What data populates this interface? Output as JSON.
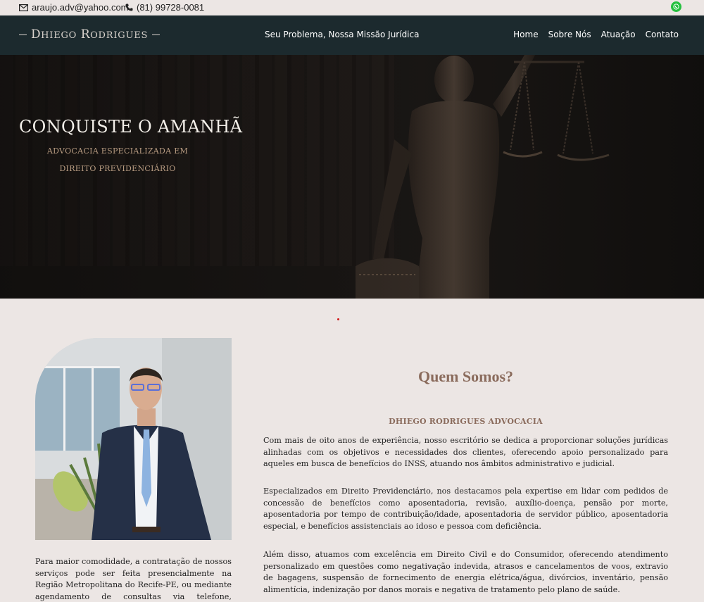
{
  "topbar": {
    "email": "araujo.adv@yahoo.com",
    "phone": "(81) 99728-0081",
    "icons": [
      "mail-icon",
      "phone-icon",
      "whatsapp-icon"
    ]
  },
  "nav": {
    "brand_first_initial": "D",
    "brand_first_rest": "hiego",
    "brand_last_initial": "R",
    "brand_last_rest": "odrigues",
    "tagline": "Seu Problema, Nossa Missão Jurídica",
    "menu": [
      "Home",
      "Sobre Nós",
      "Atuação",
      "Contato"
    ]
  },
  "hero": {
    "title": "CONQUISTE O AMANHÃ",
    "subtitle": "ADVOCACIA ESPECIALIZADA EM DIREITO PREVIDENCIÁRIO"
  },
  "about": {
    "title": "Quem Somos?",
    "subtitle": "DHIEGO RODRIGUES ADVOCACIA",
    "paragraphs": [
      "Com mais de oito anos de experiência, nosso escritório se dedica a proporcionar soluções jurídicas alinhadas com os objetivos e necessidades dos clientes, oferecendo apoio personalizado para aqueles em busca de benefícios do INSS, atuando nos âmbitos administrativo e judicial.",
      "Especializados em Direito Previdenciário, nos destacamos pela expertise em lidar com pedidos de concessão de benefícios como aposentadoria, revisão, auxílio-doença, pensão por morte, aposentadoria por tempo de contribuição/idade, aposentadoria de servidor público, aposentadoria especial, e benefícios assistenciais ao idoso e pessoa com deficiência.",
      "Além disso, atuamos com excelência em Direito Civil e do Consumidor, oferecendo atendimento personalizado em questões como negativação indevida, atrasos e cancelamentos de voos, extravio de bagagens, suspensão de fornecimento de energia elétrica/água, divórcios, inventário, pensão alimentícia, indenização por danos morais e negativa de tratamento pelo plano de saúde."
    ]
  },
  "left_text": "Para maior comodidade, a contratação de nossos serviços pode ser feita presencialmente na Região Metropolitana do Recife-PE, ou mediante agendamento de consultas via telefone, WhatsApp"
}
